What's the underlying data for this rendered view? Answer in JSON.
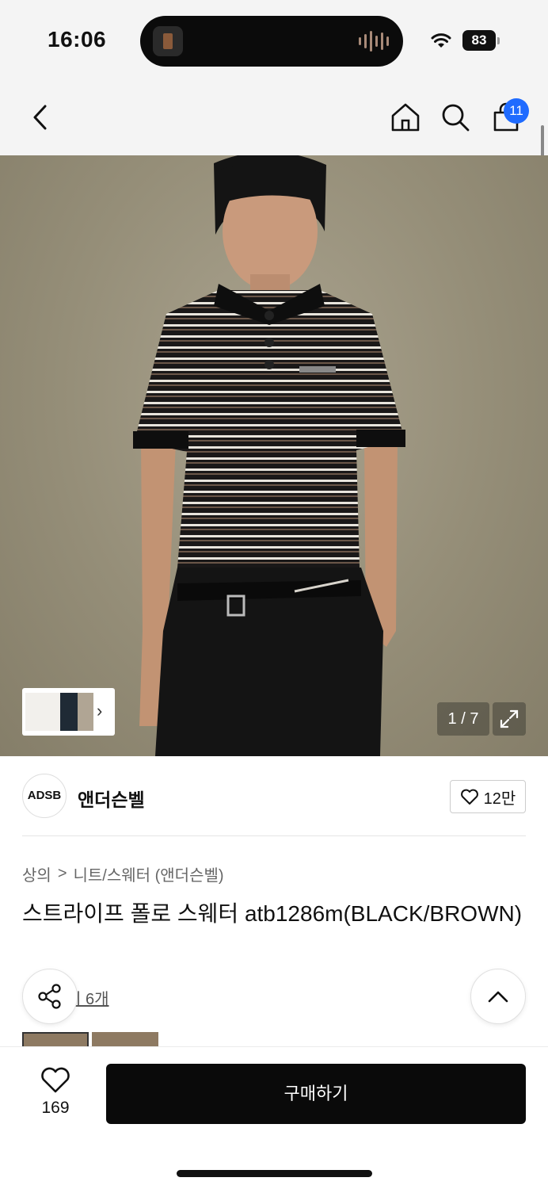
{
  "status_bar": {
    "time": "16:06",
    "battery": "83"
  },
  "nav": {
    "cart_count": "11"
  },
  "gallery": {
    "counter": "1 / 7"
  },
  "brand": {
    "logo_text": "ADSB",
    "name": "앤더슨벨",
    "like_count": "12만"
  },
  "breadcrumb": {
    "category": "상의",
    "separator": ">",
    "subcategory": "니트/스웨터 (앤더슨벨)"
  },
  "product": {
    "title": "스트라이프 폴로 스웨터 atb1286m(BLACK/BROWN)"
  },
  "reviews": {
    "link_text": "기 6개"
  },
  "bottom_bar": {
    "wish_count": "169",
    "buy_label": "구매하기"
  },
  "colors": {
    "badge": "#1f6bff",
    "buy_button": "#0a0a0a"
  }
}
